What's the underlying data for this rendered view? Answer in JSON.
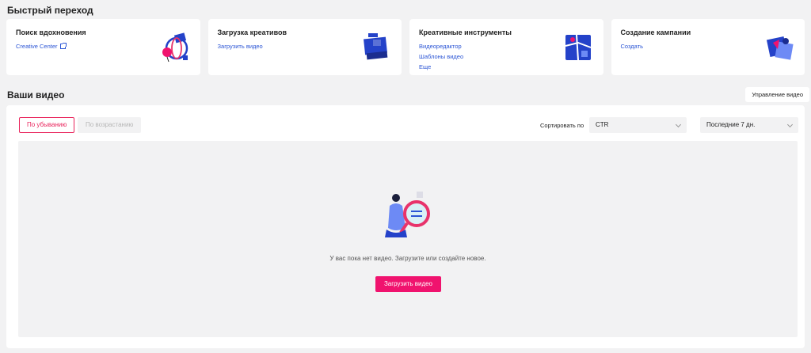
{
  "quick_access": {
    "title": "Быстрый переход",
    "cards": [
      {
        "title": "Поиск вдохновения",
        "links": [
          "Creative Center"
        ],
        "icon": "globe-balloon-icon"
      },
      {
        "title": "Загрузка креативов",
        "links": [
          "Загрузить видео"
        ],
        "icon": "upload-box-icon"
      },
      {
        "title": "Креативные инструменты",
        "links": [
          "Видеоредактор",
          "Шаблоны видео",
          "Еще"
        ],
        "icon": "tools-map-icon"
      },
      {
        "title": "Создание кампании",
        "links": [
          "Создать"
        ],
        "icon": "campaign-icon"
      }
    ]
  },
  "videos": {
    "title": "Ваши видео",
    "manage_label": "Управление видео",
    "sort_desc": "По убыванию",
    "sort_asc": "По возрастанию",
    "sort_by_label": "Сортировать по",
    "metric_value": "CTR",
    "period_value": "Последние 7 дн.",
    "empty_text": "У вас пока нет видео. Загрузите или создайте новое.",
    "upload_label": "Загрузить видео"
  },
  "colors": {
    "accent": "#f0136e",
    "link": "#2b55d5",
    "background": "#f2f2f3"
  }
}
